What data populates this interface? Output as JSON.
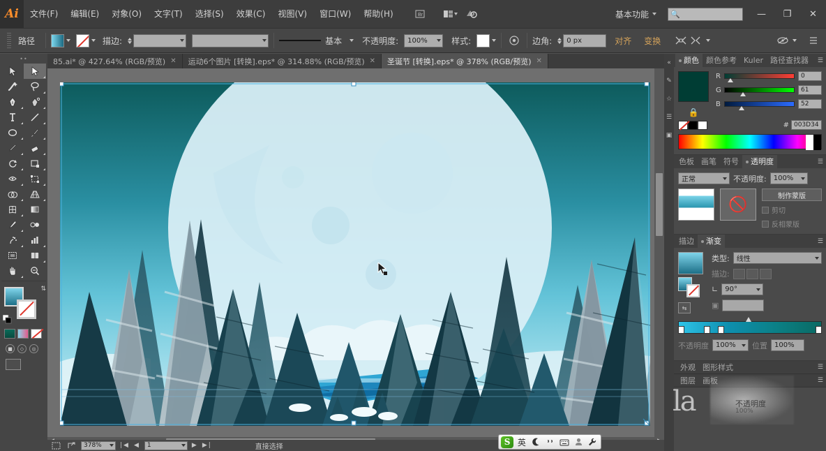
{
  "app": {
    "name": "Ai",
    "logo_text": "Ai"
  },
  "menubar": {
    "items": [
      {
        "label": "文件(F)"
      },
      {
        "label": "编辑(E)"
      },
      {
        "label": "对象(O)"
      },
      {
        "label": "文字(T)"
      },
      {
        "label": "选择(S)"
      },
      {
        "label": "效果(C)"
      },
      {
        "label": "视图(V)"
      },
      {
        "label": "窗口(W)"
      },
      {
        "label": "帮助(H)"
      }
    ],
    "bridge_icon": "bridge-icon",
    "arrange_icon": "arrange-documents-icon",
    "stock_icon": "adobe-stock-icon",
    "workspace": "基本功能",
    "search_placeholder": "",
    "search_value": "",
    "minimize": "—",
    "restore": "❐",
    "close": "✕"
  },
  "controlbar": {
    "object_label": "路径",
    "fill_label": "fill-swatch",
    "stroke_label": "stroke-swatch",
    "stroke_weight_label": "描边:",
    "stroke_weight_value": "",
    "brush_label": "基本",
    "opacity_label": "不透明度:",
    "opacity_value": "100%",
    "style_label": "样式:",
    "corner_label": "边角:",
    "corner_value": "0 px",
    "align_label": "对齐",
    "transform_label": "变换",
    "isolate_icon": "isolate-selection-icon",
    "mask_icon": "make-mask-icon",
    "menu_icon": "panel-menu-icon"
  },
  "doctabs": [
    {
      "label": "85.ai* @ 427.64% (RGB/预览)",
      "active": false,
      "close": "✕"
    },
    {
      "label": "运动6个图片 [转换].eps* @ 314.88% (RGB/预览)",
      "active": false,
      "close": "✕"
    },
    {
      "label": "圣诞节 [转换].eps* @ 378% (RGB/预览)",
      "active": true,
      "close": "✕"
    }
  ],
  "toolbar": {
    "tools": [
      {
        "name": "selection-tool",
        "glyph": "selection",
        "selected": false
      },
      {
        "name": "direct-selection-tool",
        "glyph": "direct-selection",
        "selected": true
      },
      {
        "name": "magic-wand-tool",
        "glyph": "magic-wand",
        "selected": false
      },
      {
        "name": "lasso-tool",
        "glyph": "lasso",
        "selected": false
      },
      {
        "name": "pen-tool",
        "glyph": "pen",
        "selected": false
      },
      {
        "name": "curvature-tool",
        "glyph": "curvature",
        "selected": false
      },
      {
        "name": "type-tool",
        "glyph": "type",
        "selected": false
      },
      {
        "name": "line-segment-tool",
        "glyph": "line",
        "selected": false
      },
      {
        "name": "ellipse-tool",
        "glyph": "ellipse",
        "selected": false
      },
      {
        "name": "paintbrush-tool",
        "glyph": "brush",
        "selected": false
      },
      {
        "name": "pencil-tool",
        "glyph": "pencil",
        "selected": false
      },
      {
        "name": "eraser-tool",
        "glyph": "eraser",
        "selected": false
      },
      {
        "name": "rotate-tool",
        "glyph": "rotate",
        "selected": false
      },
      {
        "name": "scale-tool",
        "glyph": "scale",
        "selected": false
      },
      {
        "name": "width-tool",
        "glyph": "width",
        "selected": false
      },
      {
        "name": "free-transform-tool",
        "glyph": "free-transform",
        "selected": false
      },
      {
        "name": "shape-builder-tool",
        "glyph": "shape-builder",
        "selected": false
      },
      {
        "name": "perspective-grid-tool",
        "glyph": "perspective",
        "selected": false
      },
      {
        "name": "mesh-tool",
        "glyph": "mesh",
        "selected": false
      },
      {
        "name": "gradient-tool",
        "glyph": "gradient",
        "selected": false
      },
      {
        "name": "eyedropper-tool",
        "glyph": "eyedropper",
        "selected": false
      },
      {
        "name": "blend-tool",
        "glyph": "blend",
        "selected": false
      },
      {
        "name": "symbol-sprayer-tool",
        "glyph": "symbol",
        "selected": false
      },
      {
        "name": "column-graph-tool",
        "glyph": "graph",
        "selected": false
      },
      {
        "name": "artboard-tool",
        "glyph": "artboard",
        "selected": false
      },
      {
        "name": "slice-tool",
        "glyph": "slice",
        "selected": false
      },
      {
        "name": "hand-tool",
        "glyph": "hand",
        "selected": false
      },
      {
        "name": "zoom-tool",
        "glyph": "zoom",
        "selected": false
      }
    ],
    "fill_color": "#1d6f87",
    "stroke_color": "none",
    "draw_modes": [
      "draw-normal",
      "draw-behind",
      "draw-inside"
    ],
    "screen_mode": "screen-mode-icon"
  },
  "canvas": {
    "artwork_title": "christmas-night-forest-illustration",
    "cursor": "direct-selection-cursor"
  },
  "colors": {
    "fill_hex": "#003D34",
    "gradient_start": "#7fd4ea",
    "gradient_end": "#1d6f87",
    "accent_orange": "#ff8e2b"
  },
  "panels": {
    "color": {
      "tabs": [
        {
          "label": "颜色",
          "active": true
        },
        {
          "label": "颜色参考",
          "active": false
        },
        {
          "label": "Kuler",
          "active": false
        },
        {
          "label": "路径查找器",
          "active": false
        }
      ],
      "menu_icon": "panel-menu-icon",
      "swatch_hex": "#003D34",
      "lock_icon": "lock-icon",
      "channels": [
        {
          "label": "R",
          "value": "0"
        },
        {
          "label": "G",
          "value": "61"
        },
        {
          "label": "B",
          "value": "52"
        }
      ],
      "hex_label": "#",
      "hex_value": "003D34",
      "none_swatch": "none-swatch",
      "black_swatch": "black-swatch",
      "white_swatch": "white-swatch"
    },
    "transparency": {
      "tabs": [
        {
          "label": "色板",
          "active": false
        },
        {
          "label": "画笔",
          "active": false
        },
        {
          "label": "符号",
          "active": false
        },
        {
          "label": "透明度",
          "active": true
        }
      ],
      "menu_icon": "panel-menu-icon",
      "blend_mode": "正常",
      "opacity_label": "不透明度:",
      "opacity_value": "100%",
      "make_mask_label": "制作蒙版",
      "clip_label": "剪切",
      "invert_label": "反相蒙版",
      "object_thumb": "object-thumbnail",
      "mask_thumb": "mask-thumbnail"
    },
    "gradient": {
      "tabs": [
        {
          "label": "描边",
          "active": false
        },
        {
          "label": "渐变",
          "active": true
        }
      ],
      "menu_icon": "panel-menu-icon",
      "type_label": "类型:",
      "type_value": "线性",
      "stroke_label": "描边:",
      "angle_label": "角度",
      "angle_value": "90°",
      "aspect_label": "长宽比",
      "aspect_value": "",
      "opacity_label": "不透明度",
      "opacity_value": "100%",
      "location_label": "位置",
      "location_value": "100%",
      "reverse_icon": "reverse-gradient-icon"
    },
    "appearance": {
      "tabs": [
        {
          "label": "外观",
          "active": false
        },
        {
          "label": "图形样式",
          "active": false
        }
      ],
      "menu_icon": "panel-menu-icon"
    },
    "layers": {
      "tabs": [
        {
          "label": "图层",
          "active": false
        },
        {
          "label": "画板",
          "active": false
        }
      ],
      "menu_icon": "panel-menu-icon"
    },
    "rail": [
      "panel-collapse-icon",
      "brush-rail-icon",
      "symbols-rail-icon",
      "align-rail-icon",
      "transform-rail-icon"
    ]
  },
  "statusbar": {
    "artboard_icon": "artboard-navigation-icon",
    "share_icon": "share-icon",
    "zoom_value": "378%",
    "page_value": "1",
    "nav_first": "|◀",
    "nav_prev": "◀",
    "nav_next": "▶",
    "nav_last": "▶|",
    "status_text": "直接选择"
  },
  "ime": {
    "logo": "S",
    "mode": "英",
    "items": [
      "moon-icon",
      "quote-icon",
      "keyboard-icon",
      "user-icon",
      "wrench-icon"
    ]
  },
  "watermark": {
    "text": "la",
    "line1": "不透明度",
    "line2": "100%"
  }
}
